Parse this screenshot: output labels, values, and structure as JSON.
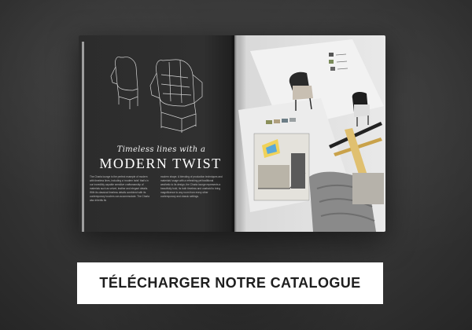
{
  "catalog": {
    "headline_script": "Timeless lines with a",
    "headline_main": "MODERN TWIST",
    "body_col_1": "The Charla lounge is the perfect example of modern with timeless lines, including a ‘modern twist’ that’s in our incredibly capable sensitive craftsmanship of materials such as velvet, leather and elegant details. With its classical timeless details combined with its contemporary touches can accommodate. The Charla also inherits its",
    "body_col_2": "modern shape. A blending of production techniques and materials’ usage with a refreshing yet traditional aesthetic to its design, the Charla lounge represents a beautifully bold, its both timeless and unafraid to bring magnificence to any room from every other contemporary and classic settings."
  },
  "cta": {
    "label": "TÉLÉCHARGER NOTRE CATALOGUE"
  },
  "colors": {
    "background": "#3a3a3a",
    "page_left": "#2e2e2e",
    "page_right": "#e6e6e6",
    "button_bg": "#ffffff",
    "button_text": "#1e1e1e"
  }
}
